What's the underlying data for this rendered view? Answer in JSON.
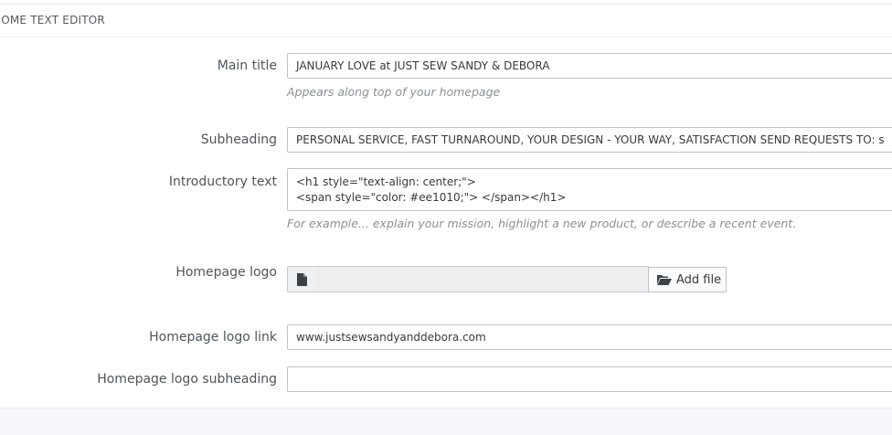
{
  "panel": {
    "header": "HOME TEXT EDITOR"
  },
  "fields": {
    "main_title": {
      "label": "Main title",
      "value": "JANUARY LOVE at JUST SEW SANDY & DEBORA",
      "help": "Appears along top of your homepage"
    },
    "subheading": {
      "label": "Subheading",
      "value": "PERSONAL SERVICE, FAST TURNAROUND, YOUR DESIGN - YOUR WAY, SATISFACTION SEND REQUESTS TO: s"
    },
    "intro_text": {
      "label": "Introductory text",
      "value": "<h1 style=\"text-align: center;\">\n<span style=\"color: #ee1010;\"> </span></h1>",
      "help": "For example... explain your mission, highlight a new product, or describe a recent event."
    },
    "homepage_logo": {
      "label": "Homepage logo",
      "file_name": "",
      "button_label": "Add file",
      "icons": [
        "file-icon",
        "folder-open-icon"
      ]
    },
    "homepage_logo_link": {
      "label": "Homepage logo link",
      "value": "www.justsewsandyanddebora.com"
    },
    "homepage_logo_subheading": {
      "label": "Homepage logo subheading",
      "value": ""
    }
  }
}
